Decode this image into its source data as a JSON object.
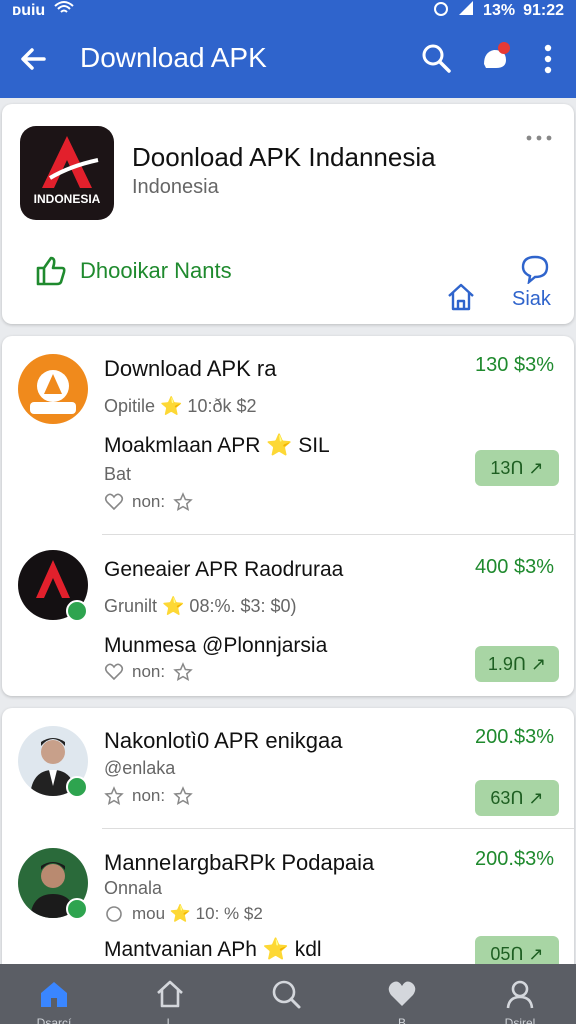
{
  "colors": {
    "primary": "#2f64cc",
    "green": "#1f8a2e",
    "pill": "#a8d5a4",
    "nav_bg": "#5b5e65"
  },
  "status_bar": {
    "carrier": "ᴅuiu",
    "battery": "13%",
    "time": "91:22"
  },
  "app_bar": {
    "title": "Download APK"
  },
  "header": {
    "icon_text": "INDONESIA",
    "app_name": "Doonload APK Indannesia",
    "subtitle": "Indonesia",
    "like_label": "Dhooikar Nants",
    "chat_label": "Siak"
  },
  "items": [
    {
      "title": "Download APK ra",
      "meta": "Opitile ⭐ 10:ðk $2",
      "desc": "Moakmlaan APR ⭐ SIL",
      "note": "Bat",
      "actions": "non:",
      "price": "130 $3%",
      "pill": "13Ո ↗"
    },
    {
      "title": "Geneaier APR Raodruraa",
      "meta": "Grunilt ⭐ 08:%. $3: $0)",
      "desc": "Munmesa @Plonnjarsia",
      "note": "",
      "actions": "non:",
      "price": "400 $3%",
      "pill": "1.9Ո ↗"
    },
    {
      "title": "Nakonlotì0 APR enikgaa",
      "meta": "@enlaka",
      "desc": "",
      "note": "",
      "actions": "non:",
      "price": "200.$3%",
      "pill": "63Ո ↗"
    },
    {
      "title": "ManneIargbaRPk Podapaia",
      "meta": "Onnala",
      "desc": "Mantvanian APh ⭐ kdl",
      "note": "",
      "actions": "mou  ⭐ 10: % $2",
      "price": "200.$3%",
      "pill": "05Ո ↗"
    }
  ],
  "bottom_nav": [
    {
      "label": "Dsarcí",
      "icon": "home-filled-icon"
    },
    {
      "label": "L",
      "icon": "home-outline-icon"
    },
    {
      "label": "",
      "icon": "search-icon"
    },
    {
      "label": "B",
      "icon": "heart-icon"
    },
    {
      "label": "Dsirel",
      "icon": "user-icon"
    }
  ]
}
